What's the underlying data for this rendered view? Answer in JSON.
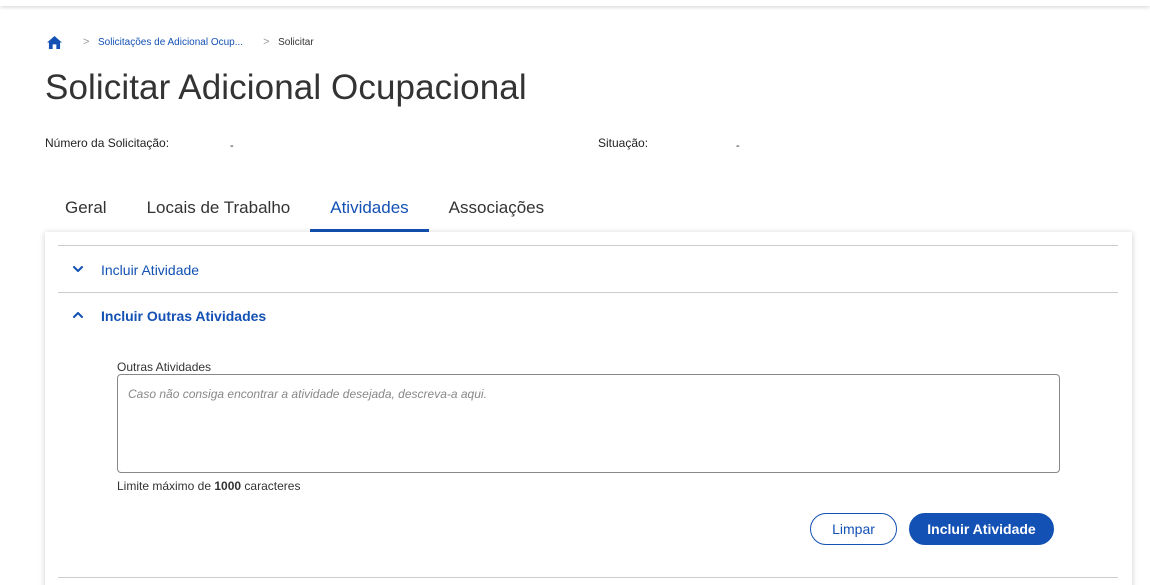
{
  "breadcrumb": {
    "home_icon": "home-icon",
    "items": [
      "Solicitações de Adicional Ocup...",
      "Solicitar"
    ],
    "separator": ">"
  },
  "page": {
    "title": "Solicitar Adicional Ocupacional"
  },
  "info": {
    "numero_label": "Número da Solicitação:",
    "numero_value": "-",
    "situacao_label": "Situação:",
    "situacao_value": "-"
  },
  "tabs": [
    {
      "label": "Geral",
      "active": false
    },
    {
      "label": "Locais de Trabalho",
      "active": false
    },
    {
      "label": "Atividades",
      "active": true
    },
    {
      "label": "Associações",
      "active": false
    }
  ],
  "accordion": {
    "incluir_atividade": {
      "label": "Incluir Atividade",
      "icon": "chevron-down-icon"
    },
    "incluir_outras": {
      "label": "Incluir Outras Atividades",
      "icon": "chevron-up-icon"
    }
  },
  "form": {
    "field_label": "Outras Atividades",
    "placeholder": "Caso não consiga encontrar a atividade desejada, descreva-a aqui.",
    "value": "",
    "limit_prefix": "Limite máximo de",
    "limit_value": "1000",
    "limit_suffix": "caracteres"
  },
  "buttons": {
    "clear_label": "Limpar",
    "submit_label": "Incluir Atividade"
  },
  "colors": {
    "primary": "#1351b4",
    "text": "#333333",
    "divider": "#cccccc"
  }
}
